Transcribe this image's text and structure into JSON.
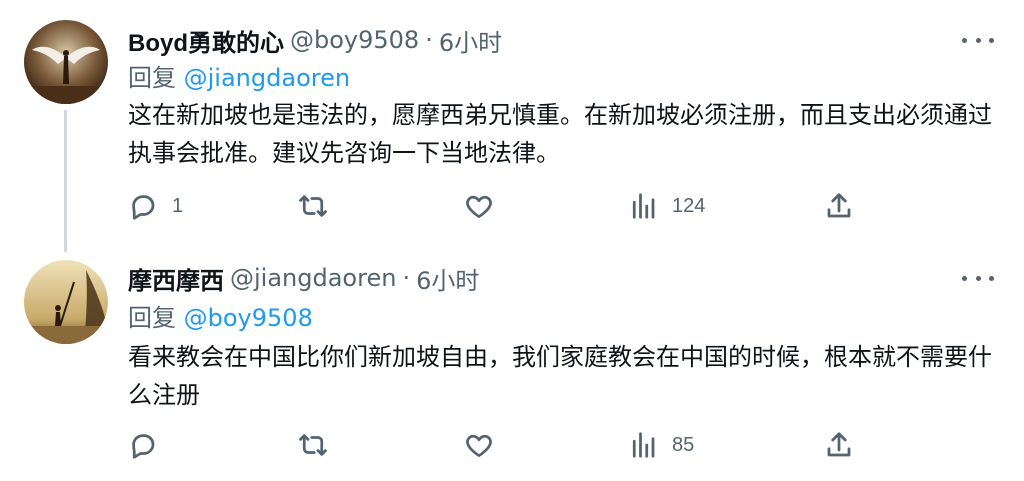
{
  "colors": {
    "link": "#1d9bf0",
    "secondary_text": "#536471",
    "primary_text": "#0f1419",
    "thread_line": "#cfd9de"
  },
  "tweets": [
    {
      "author_name": "Boyd勇敢的心",
      "handle": "@boy9508",
      "separator": "·",
      "time": "6小时",
      "reply_prefix": "回复 ",
      "reply_to": "@jiangdaoren",
      "text": "这在新加坡也是违法的，愿摩西弟兄慎重。在新加坡必须注册，而且支出必须通过执事会批准。建议先咨询一下当地法律。",
      "avatar_icon": "angel-wings-avatar",
      "actions": {
        "reply_icon": "reply-bubble-icon",
        "reply_count": "1",
        "retweet_icon": "retweet-icon",
        "retweet_count": "",
        "like_icon": "heart-icon",
        "like_count": "",
        "views_icon": "views-chart-icon",
        "views_count": "124",
        "share_icon": "share-icon"
      }
    },
    {
      "author_name": "摩西摩西",
      "handle": "@jiangdaoren",
      "separator": "·",
      "time": "6小时",
      "reply_prefix": "回复 ",
      "reply_to": "@boy9508",
      "text": "看来教会在中国比你们新加坡自由，我们家庭教会在中国的时候，根本就不需要什么注册",
      "avatar_icon": "moses-silhouette-avatar",
      "actions": {
        "reply_icon": "reply-bubble-icon",
        "reply_count": "",
        "retweet_icon": "retweet-icon",
        "retweet_count": "",
        "like_icon": "heart-icon",
        "like_count": "",
        "views_icon": "views-chart-icon",
        "views_count": "85",
        "share_icon": "share-icon"
      }
    }
  ]
}
